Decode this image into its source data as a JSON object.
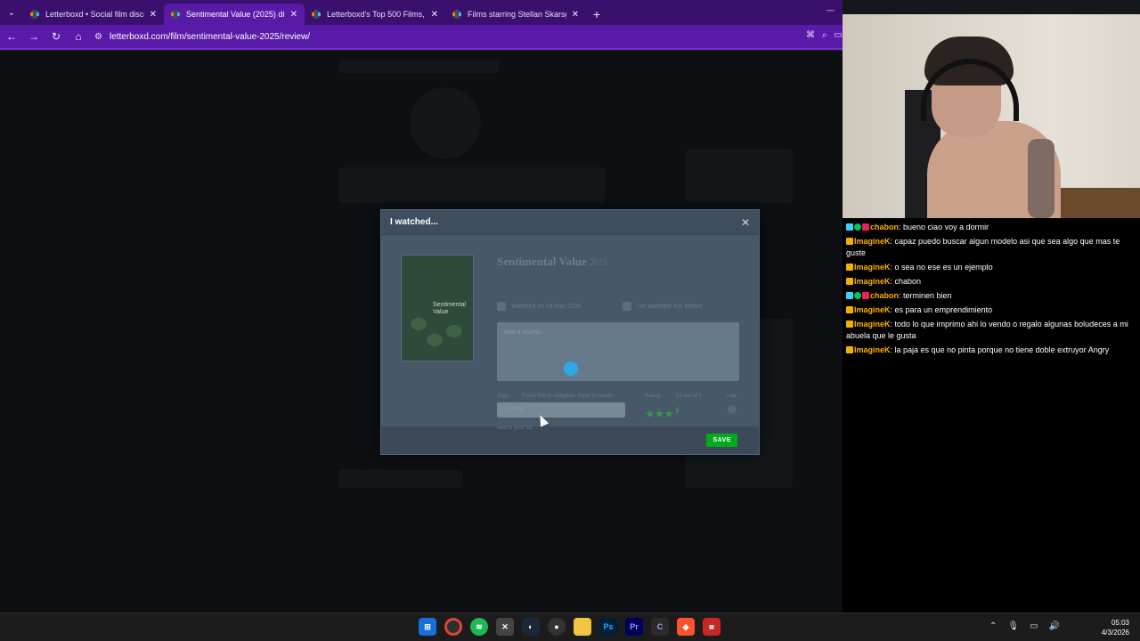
{
  "browser": {
    "tabs": [
      {
        "title": "Letterboxd • Social film discove",
        "active": false
      },
      {
        "title": "Sentimental Value (2025) direct",
        "active": true
      },
      {
        "title": "Letterboxd's Top 500 Films, a li",
        "active": false
      },
      {
        "title": "Films starring Stellan Skarsgård",
        "active": false
      }
    ],
    "url": "letterboxd.com/film/sentimental-value-2025/review/"
  },
  "modal": {
    "title": "I watched...",
    "film_title": "Sentimental Value",
    "film_year": "2025",
    "poster_title": "Sentimental Value",
    "watched_on_label": "Watched on",
    "watched_on_date": "04 Mar 2026",
    "rewatch_label": "I've watched this before",
    "review_placeholder": "Add a review...",
    "tags_label": "Tags",
    "tags_hint": "Press Tab to complete, Enter to create",
    "tags_placeholder": "eg. netflix",
    "rating_label": "Rating",
    "rating_value": "3.5 out of 5",
    "rating_stars": 3.5,
    "like_label": "Like",
    "extra_label": "Add to your list",
    "save_label": "SAVE"
  },
  "chat": {
    "messages": [
      {
        "badges": [
          "sword",
          "check",
          "mod"
        ],
        "user": "chabon",
        "color": "#ffb000",
        "text": "bueno ciao voy a dormir"
      },
      {
        "badges": [
          "crown"
        ],
        "user": "ImagineK",
        "color": "#ffb000",
        "text": "capaz puedo buscar algun modelo asi que sea algo que mas te guste"
      },
      {
        "badges": [
          "crown"
        ],
        "user": "ImagineK",
        "color": "#ffb000",
        "text": "o sea no ese es un ejemplo"
      },
      {
        "badges": [
          "crown"
        ],
        "user": "ImagineK",
        "color": "#ffb000",
        "text": "chabon"
      },
      {
        "badges": [
          "sword",
          "check",
          "mod"
        ],
        "user": "chabon",
        "color": "#ffb000",
        "text": "terminen bien"
      },
      {
        "badges": [
          "crown"
        ],
        "user": "ImagineK",
        "color": "#ffb000",
        "text": "es para un emprendimiento"
      },
      {
        "badges": [
          "crown"
        ],
        "user": "ImagineK",
        "color": "#ffb000",
        "text": "todo lo que imprimo ahi lo vendo o regalo algunas boludeces a mi abuela que le gusta"
      },
      {
        "badges": [
          "crown"
        ],
        "user": "ImagineK",
        "color": "#ffb000",
        "text": "la paja es que no pinta porque no tiene doble extruyor Angry"
      }
    ]
  },
  "taskbar": {
    "apps": [
      "windows-start",
      "chrome",
      "spotify",
      "xbox",
      "steam",
      "obs",
      "file-explorer",
      "photoshop",
      "premiere",
      "ccleaner",
      "brave",
      "lottie"
    ],
    "photoshop_label": "Ps",
    "premiere_label": "Pr",
    "time": "05:03",
    "date": "4/3/2026"
  }
}
